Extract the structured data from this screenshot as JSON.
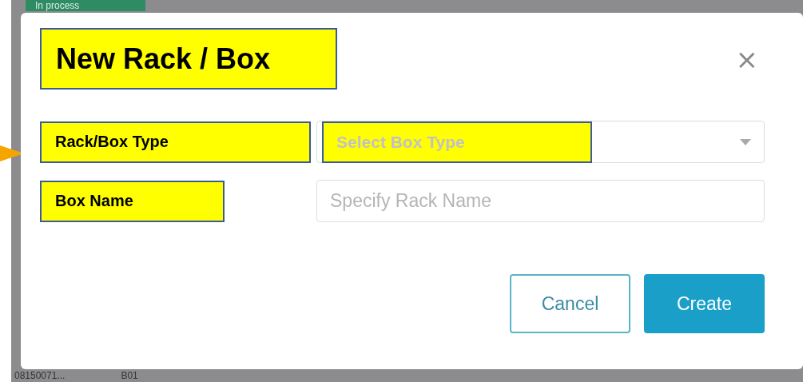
{
  "background": {
    "badge": "In process",
    "row": [
      "08150071...",
      "B01"
    ]
  },
  "dialog": {
    "title": "New Rack / Box",
    "close": "×",
    "fields": [
      {
        "label": "Rack/Box Type",
        "kind": "select",
        "placeholder": "Select Box Type"
      },
      {
        "label": "Box Name",
        "kind": "text",
        "placeholder": "Specify Rack Name"
      }
    ],
    "buttons": [
      {
        "label": "Cancel",
        "kind": "secondary"
      },
      {
        "label": "Create",
        "kind": "primary"
      }
    ]
  }
}
